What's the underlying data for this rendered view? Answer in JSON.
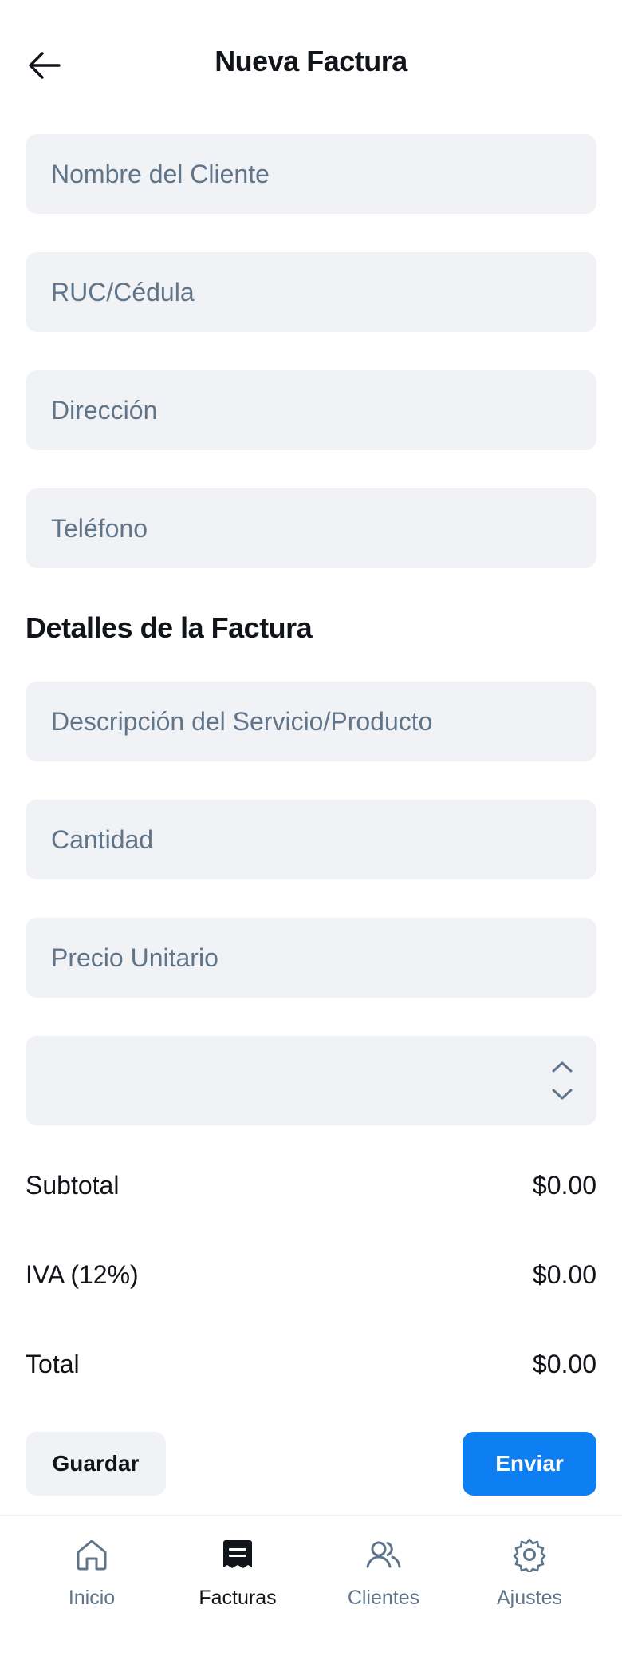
{
  "header": {
    "title": "Nueva Factura",
    "back_icon": "arrow-left-icon"
  },
  "client_form": {
    "name_placeholder": "Nombre del Cliente",
    "name_value": "",
    "id_placeholder": "RUC/Cédula",
    "id_value": "",
    "address_placeholder": "Dirección",
    "address_value": "",
    "phone_placeholder": "Teléfono",
    "phone_value": ""
  },
  "details": {
    "section_title": "Detalles de la Factura",
    "description_placeholder": "Descripción del Servicio/Producto",
    "description_value": "",
    "quantity_placeholder": "Cantidad",
    "quantity_value": "",
    "unit_price_placeholder": "Precio Unitario",
    "unit_price_value": "",
    "select_value": ""
  },
  "summary": {
    "subtotal_label": "Subtotal",
    "subtotal_value": "$0.00",
    "tax_label": "IVA (12%)",
    "tax_value": "$0.00",
    "total_label": "Total",
    "total_value": "$0.00"
  },
  "actions": {
    "save_label": "Guardar",
    "send_label": "Enviar"
  },
  "nav": {
    "items": [
      {
        "label": "Inicio",
        "icon": "home-icon",
        "active": false
      },
      {
        "label": "Facturas",
        "icon": "receipt-icon",
        "active": true
      },
      {
        "label": "Clientes",
        "icon": "users-icon",
        "active": false
      },
      {
        "label": "Ajustes",
        "icon": "gear-icon",
        "active": false
      }
    ]
  },
  "colors": {
    "accent": "#0d7ff2",
    "field_bg": "#f0f2f5",
    "muted_text": "#60758a",
    "text": "#111418"
  }
}
